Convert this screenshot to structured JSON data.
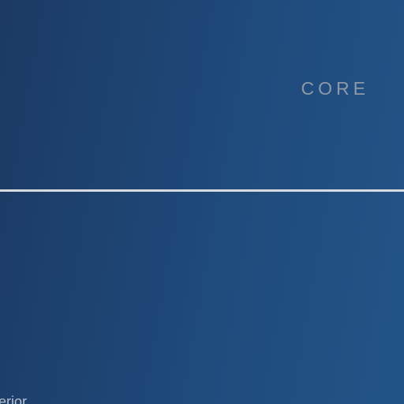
{
  "hero": {
    "label": "CORE"
  },
  "footer": {
    "partial_text": "terior"
  },
  "colors": {
    "background_start": "#1c3a63",
    "background_end": "#235488",
    "label": "#8f99a6",
    "divider": "#d7dbe0",
    "partial_text": "#b7c0cc"
  }
}
